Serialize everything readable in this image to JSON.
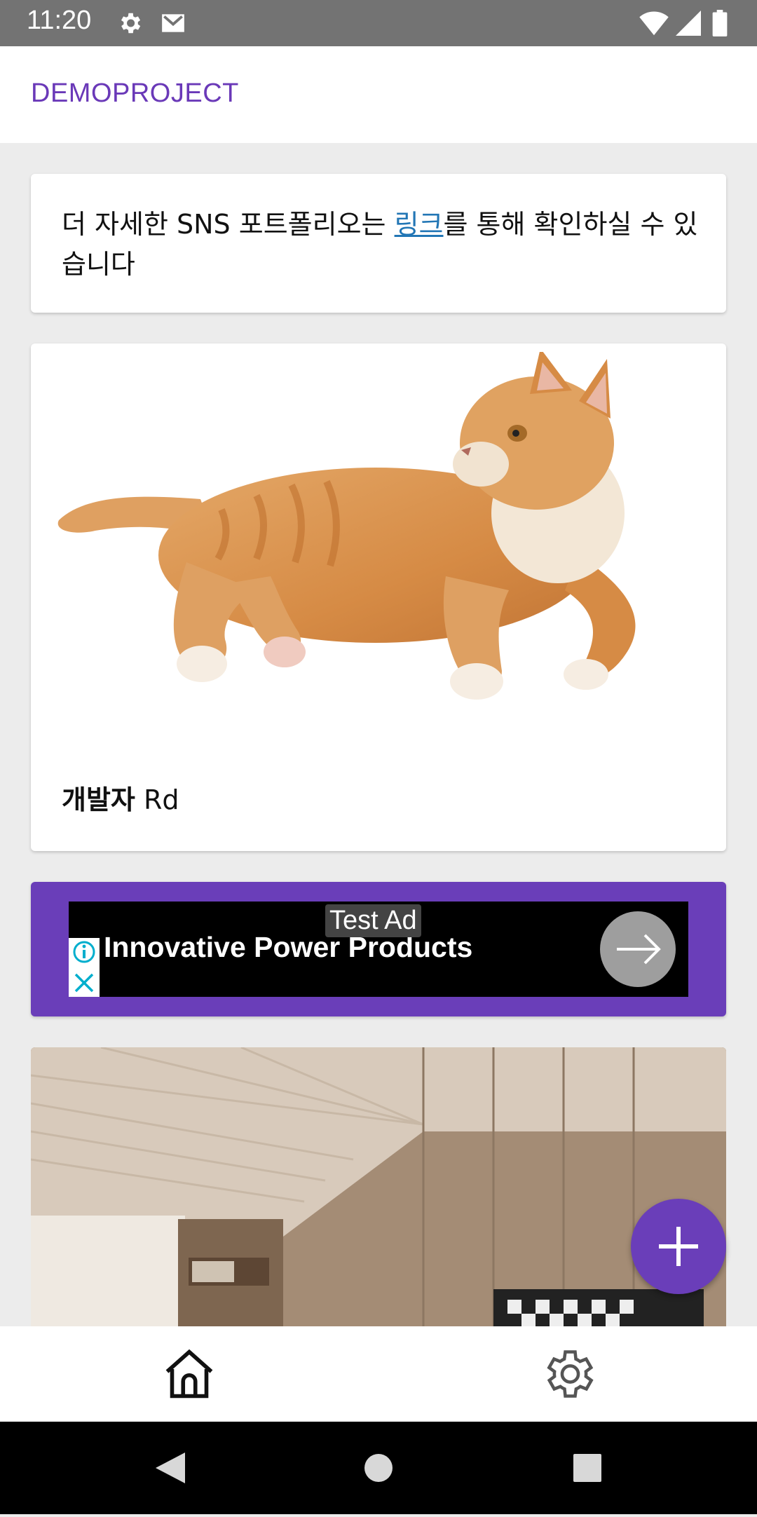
{
  "status_bar": {
    "time": "11:20",
    "icons": [
      "gear-icon",
      "gmail-icon",
      "wifi-icon",
      "signal-icon",
      "battery-icon"
    ]
  },
  "app_bar": {
    "title": "DEMOPROJECT"
  },
  "info_card": {
    "text_before": "더 자세한 SNS 포트폴리오는 ",
    "link_text": "링크",
    "text_after": "를 통해 확인하실 수 있습니다"
  },
  "post_card": {
    "caption_bold": "개발자",
    "caption_rest": " Rd"
  },
  "ad": {
    "test_label": "Test Ad",
    "headline": "Innovative Power Products"
  },
  "bottom_nav": {
    "items": [
      "home-icon",
      "settings-icon"
    ]
  },
  "colors": {
    "accent": "#6a3eb9",
    "link": "#2276b5"
  }
}
